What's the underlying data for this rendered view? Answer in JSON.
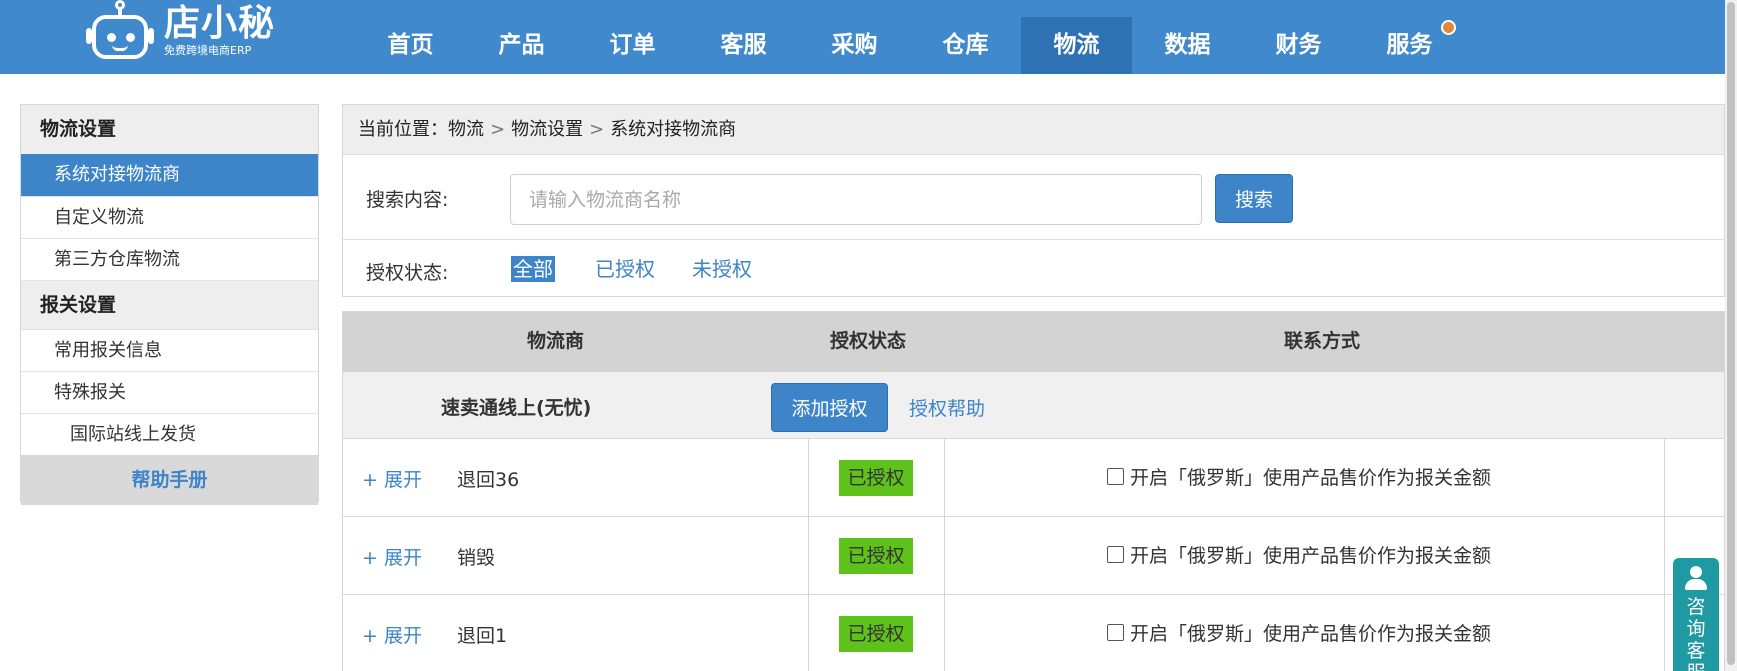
{
  "logo": {
    "name": "店小秘",
    "slogan": "免费跨境电商ERP"
  },
  "nav": {
    "items": [
      "首页",
      "产品",
      "订单",
      "客服",
      "采购",
      "仓库",
      "物流",
      "数据",
      "财务",
      "服务"
    ],
    "active": "物流"
  },
  "sidebar": {
    "section1": "物流设置",
    "item_system_carrier": "系统对接物流商",
    "item_custom": "自定义物流",
    "item_third_party": "第三方仓库物流",
    "section2": "报关设置",
    "item_common_customs": "常用报关信息",
    "item_special_customs": "特殊报关",
    "item_intl_online": "国际站线上发货",
    "help": "帮助手册"
  },
  "breadcrumb": {
    "prefix": "当前位置：",
    "crumb1": "物流",
    "crumb2": "物流设置",
    "crumb3": "系统对接物流商",
    "separator": ">"
  },
  "search": {
    "label": "搜索内容:",
    "placeholder": "请输入物流商名称",
    "value": "",
    "button": "搜索"
  },
  "filter": {
    "label": "授权状态:",
    "all": "全部",
    "authorized": "已授权",
    "unauthorized": "未授权",
    "active": "全部"
  },
  "table": {
    "headers": {
      "carrier": "物流商",
      "status": "授权状态",
      "contact": "联系方式"
    },
    "group": {
      "name": "速卖通线上(无忧)",
      "add_button": "添加授权",
      "help_link": "授权帮助"
    },
    "rows": [
      {
        "expand": "+ 展开",
        "name": "退回36",
        "status": "已授权",
        "option": "开启「俄罗斯」使用产品售价作为报关金额",
        "checked": false
      },
      {
        "expand": "+ 展开",
        "name": "销毁",
        "status": "已授权",
        "option": "开启「俄罗斯」使用产品售价作为报关金额",
        "checked": false
      },
      {
        "expand": "+ 展开",
        "name": "退回1",
        "status": "已授权",
        "option": "开启「俄罗斯」使用产品售价作为报关金额",
        "checked": false
      }
    ]
  },
  "chat": {
    "label": "咨询客服"
  },
  "colors": {
    "brand": "#4089cd",
    "nav_active": "#2f72b3",
    "accent": "#3d85c8",
    "authorized_badge": "#5fc21a",
    "chat": "#1f9aa2",
    "notice_dot": "#e1873a"
  }
}
